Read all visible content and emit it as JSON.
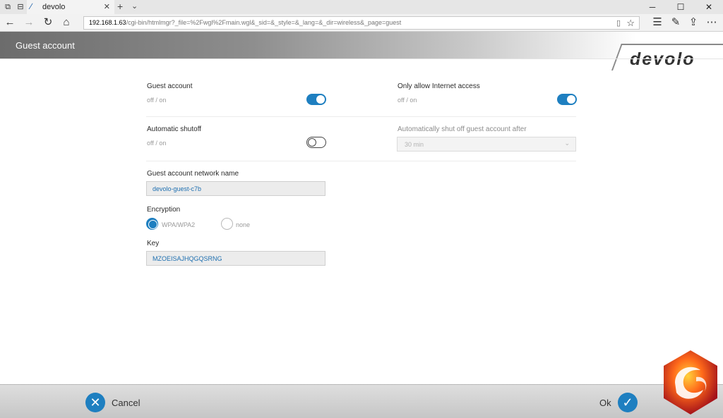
{
  "browser": {
    "tab_title": "devolo",
    "address_host": "192.168.1.63",
    "address_path": "/cgi-bin/htmlmgr?_file=%2Fwgl%2Fmain.wgl&_sid=&_style=&_lang=&_dir=wireless&_page=guest"
  },
  "header": {
    "title": "Guest account",
    "logo": "devolo"
  },
  "form": {
    "guest_account": {
      "label": "Guest account",
      "sub": "off / on",
      "state": "on"
    },
    "internet_only": {
      "label": "Only allow Internet access",
      "sub": "off / on",
      "state": "on"
    },
    "auto_shutoff": {
      "label": "Automatic shutoff",
      "sub": "off / on",
      "state": "off"
    },
    "shutoff_after": {
      "label": "Automatically shut off guest account after",
      "value": "30 min"
    },
    "network_name": {
      "label": "Guest account network name",
      "value": "devolo-guest-c7b"
    },
    "encryption": {
      "label": "Encryption",
      "options": [
        "WPA/WPA2",
        "none"
      ],
      "selected": "WPA/WPA2"
    },
    "key": {
      "label": "Key",
      "value": "MZOEISAJHQGQSRNG"
    }
  },
  "footer": {
    "cancel_label": "Cancel",
    "ok_label": "Ok"
  },
  "colors": {
    "accent": "#1e7fc0"
  }
}
